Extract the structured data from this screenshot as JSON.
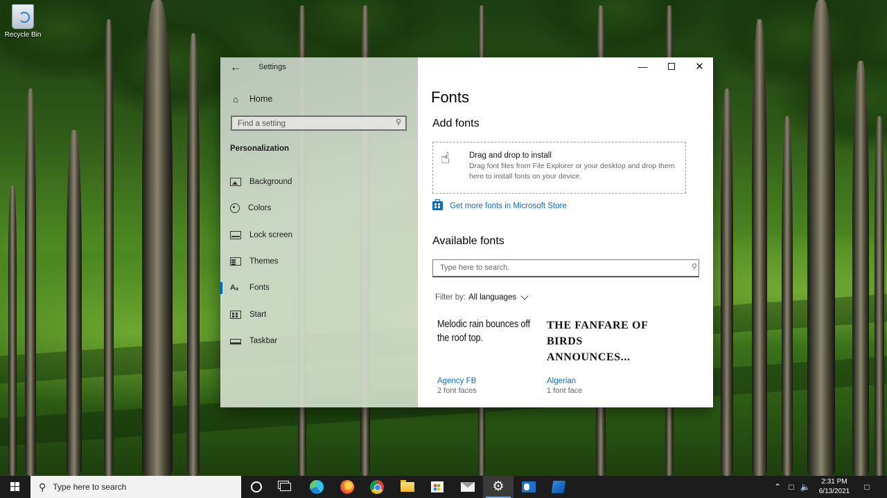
{
  "desktop": {
    "recycle_bin_label": "Recycle Bin"
  },
  "window": {
    "title": "Settings",
    "back_icon": "arrow-left-icon",
    "controls": [
      "minimize",
      "maximize",
      "close"
    ]
  },
  "sidebar": {
    "home_label": "Home",
    "search_placeholder": "Find a setting",
    "section_title": "Personalization",
    "items": [
      {
        "label": "Background",
        "icon": "background-icon"
      },
      {
        "label": "Colors",
        "icon": "palette-icon"
      },
      {
        "label": "Lock screen",
        "icon": "lock-screen-icon"
      },
      {
        "label": "Themes",
        "icon": "themes-icon"
      },
      {
        "label": "Fonts",
        "icon": "fonts-icon",
        "selected": true
      },
      {
        "label": "Start",
        "icon": "start-icon"
      },
      {
        "label": "Taskbar",
        "icon": "taskbar-icon"
      }
    ]
  },
  "main": {
    "page_title": "Fonts",
    "add_fonts_title": "Add fonts",
    "drop_title": "Drag and drop to install",
    "drop_description": "Drag font files from File Explorer or your desktop and drop them here to install fonts on your device.",
    "store_link": "Get more fonts in Microsoft Store",
    "available_title": "Available fonts",
    "search_placeholder": "Type here to search.",
    "filter_label": "Filter by:",
    "filter_value": "All languages",
    "fonts": [
      {
        "sample": "Melodic rain bounces off the roof top.",
        "name": "Agency FB",
        "faces": "2 font faces"
      },
      {
        "sample": "THE FANFARE OF BIRDS ANNOUNCES...",
        "name": "Algerian",
        "faces": "1 font face"
      }
    ]
  },
  "taskbar": {
    "search_placeholder": "Type here to search",
    "apps": [
      "cortana-icon",
      "task-view-icon",
      "edge-icon",
      "firefox-icon",
      "chrome-icon",
      "file-explorer-icon",
      "store-icon",
      "mail-icon",
      "settings-icon",
      "outlook-icon",
      "azure-icon"
    ],
    "active_app": "settings-icon",
    "time": "2:31 PM",
    "date": "6/13/2021"
  },
  "colors": {
    "accent": "#0067c0",
    "link": "#0a6ec2",
    "taskbar": "#1c1c1c"
  }
}
